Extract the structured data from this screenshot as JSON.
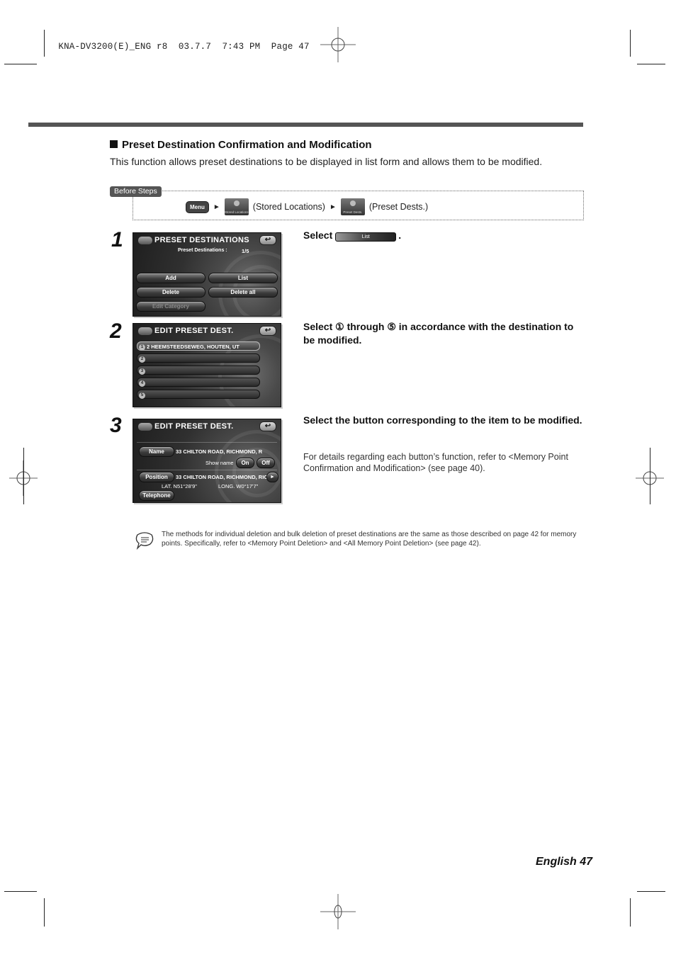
{
  "print_header": {
    "slug": "KNA-DV3200(E)_ENG r8",
    "date": "03.7.7",
    "time": "7:43 PM",
    "page_label": "Page 47"
  },
  "section": {
    "title": "Preset Destination Confirmation and Modification",
    "intro": "This function allows preset destinations to be displayed in list form and allows them to be modified."
  },
  "before_steps": {
    "tag": "Before Steps",
    "menu_button": "Menu",
    "stored_icon_label": "Stored Locations",
    "stored_caption": "(Stored Locations)",
    "preset_icon_label": "Preset Dests.",
    "preset_caption": "(Preset Dests.)",
    "arrow": "►"
  },
  "steps": [
    {
      "number": "1",
      "screen": {
        "title": "PRESET DESTINATIONS",
        "back_icon": "↩",
        "count_label": "Preset Destinations :",
        "count_value": "1/5",
        "buttons": [
          "Add",
          "List",
          "Delete",
          "Delete all",
          "Edit Category"
        ]
      },
      "instruction_prefix": "Select",
      "instruction_button": "List",
      "instruction_suffix": "."
    },
    {
      "number": "2",
      "screen": {
        "title": "EDIT PRESET DEST.",
        "back_icon": "↩",
        "items": [
          {
            "num": "1",
            "label": "2 HEEMSTEEDSEWEG, HOUTEN, UT"
          },
          {
            "num": "2",
            "label": ""
          },
          {
            "num": "3",
            "label": ""
          },
          {
            "num": "4",
            "label": ""
          },
          {
            "num": "5",
            "label": ""
          }
        ]
      },
      "instruction": "Select ① through ⑤ in accordance with the destination to be modified."
    },
    {
      "number": "3",
      "screen": {
        "title": "EDIT PRESET DEST.",
        "back_icon": "↩",
        "name_button": "Name",
        "name_value": "33 CHILTON ROAD, RICHMOND, R",
        "show_name_label": "Show name",
        "on_button": "On",
        "off_button": "Off",
        "position_button": "Position",
        "position_value": "33 CHILTON ROAD, RICHMOND, RIC",
        "play_icon": "►",
        "lat": "LAT. N51°28'9\"",
        "long": "LONG. W0°17'7\"",
        "telephone_button": "Telephone"
      },
      "instruction": "Select the button corresponding to the item to be modified.",
      "detail": "For details regarding each button’s function, refer to <Memory Point Confirmation and Modification> (see page 40)."
    }
  ],
  "note": "The methods for individual deletion and bulk deletion of preset destinations are the same as those described on page 42 for memory points. Specifically, refer to <Memory Point Deletion> and <All Memory Point Deletion> (see page 42).",
  "footer": "English 47"
}
